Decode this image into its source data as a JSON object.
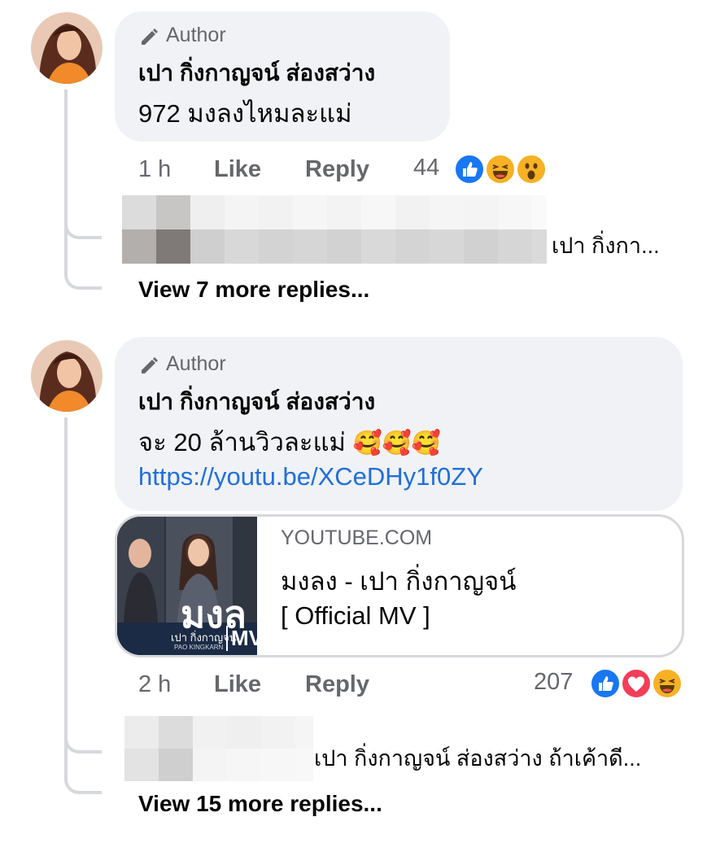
{
  "comments": [
    {
      "author_badge": "Author",
      "name": "เปา กิ่งกาญจน์ ส่องสว่าง",
      "text": "972 มงลงไหมละแม่",
      "time": "1 h",
      "like_label": "Like",
      "reply_label": "Reply",
      "reaction_count": "44",
      "reactions": [
        "like-icon",
        "haha-icon",
        "wow-icon"
      ],
      "reply_preview": "เปา กิ่งกา...",
      "view_more": "View 7 more replies..."
    },
    {
      "author_badge": "Author",
      "name": "เปา กิ่งกาญจน์ ส่องสว่าง",
      "text": "จะ 20 ล้านวิวละแม่",
      "emoji": "🥰🥰🥰",
      "link": "https://youtu.be/XCeDHy1f0ZY",
      "card": {
        "domain": "YOUTUBE.COM",
        "title_line1": "มงลง - เปา กิ่งกาญจน์",
        "title_line2": "[ Official MV ]",
        "thumb_text": "มงล",
        "thumb_caption": "เปา กิ่งกาญจน์",
        "thumb_sub": "PAO KINGKARN",
        "thumb_mv": "MV"
      },
      "time": "2 h",
      "like_label": "Like",
      "reply_label": "Reply",
      "reaction_count": "207",
      "reactions": [
        "like-icon",
        "love-icon",
        "haha-icon"
      ],
      "reply_preview": "เปา กิ่งกาญจน์ ส่องสว่าง ถ้าเค้าดี...",
      "view_more": "View 15 more replies..."
    }
  ],
  "colors": {
    "bubble_bg": "#f0f2f5",
    "link": "#216fdb",
    "secondary_text": "#65676b",
    "like_blue": "#1877f2",
    "love_red": "#f33e58",
    "haha_yellow": "#f7b125"
  }
}
